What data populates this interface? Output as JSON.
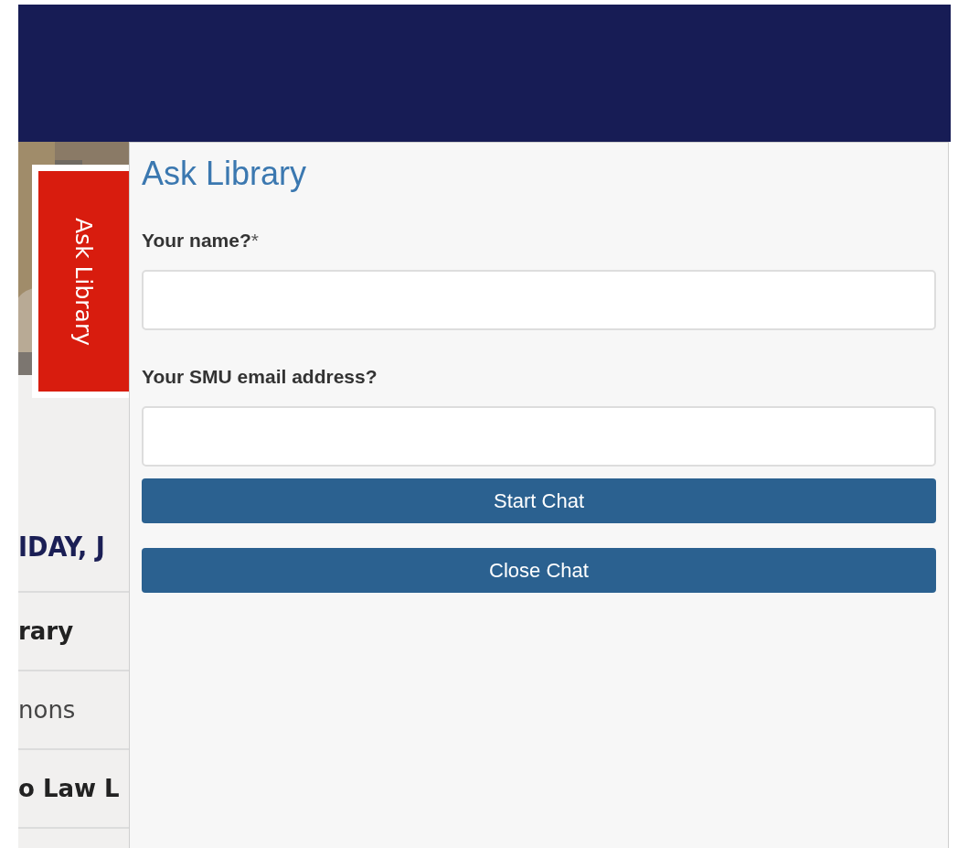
{
  "page": {
    "date_heading": "IDAY, J",
    "list_rows": [
      {
        "text": "rary",
        "bold": true
      },
      {
        "text": "nons",
        "bold": false
      },
      {
        "text": "o Law L",
        "bold": true
      }
    ]
  },
  "chat_tab": {
    "label": "Ask Library"
  },
  "chat_panel": {
    "title": "Ask Library",
    "fields": [
      {
        "label": "Your name?",
        "required_mark": "*"
      },
      {
        "label": "Your SMU email address?"
      }
    ],
    "buttons": [
      "Start Chat",
      "Close Chat"
    ]
  }
}
